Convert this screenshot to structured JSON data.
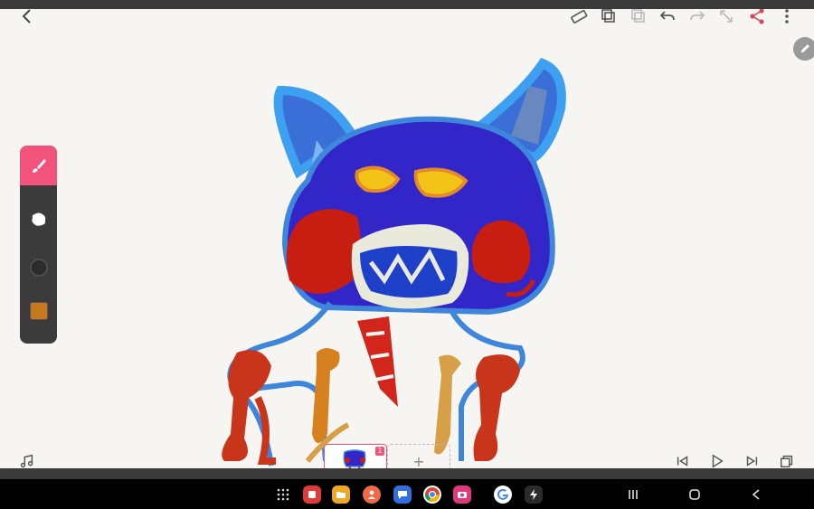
{
  "toolbar": {
    "back": "back-icon",
    "ruler": "ruler-icon",
    "copy": "copy-icon",
    "paste": "paste-icon",
    "undo": "undo-icon",
    "redo": "redo-icon",
    "resize": "resize-icon",
    "share": "share-icon",
    "more": "more-icon"
  },
  "tools": {
    "active": "brush-icon",
    "eraser": "eraser-icon",
    "size_dot": "brush-size-icon",
    "color_swatch": "#c8781c"
  },
  "colors": {
    "accent": "#f1537a",
    "panel": "#3b3b3b",
    "share": "#d24a5e"
  },
  "timeline": {
    "frame_number": "1",
    "add_frame_label": "+"
  },
  "playback": {
    "music": "music-icon",
    "first": "skip-first-icon",
    "play": "play-icon",
    "last": "skip-last-icon",
    "layers": "layers-icon"
  },
  "dock": {
    "apps": [
      "grid-icon",
      "flipaclip-icon",
      "files-icon",
      "contacts-icon",
      "messages-icon",
      "chrome-icon",
      "camera-icon",
      "google-icon",
      "bolt-icon"
    ]
  },
  "navbar": {
    "recents": "recents-icon",
    "home": "home-icon",
    "back": "nav-back-icon"
  }
}
